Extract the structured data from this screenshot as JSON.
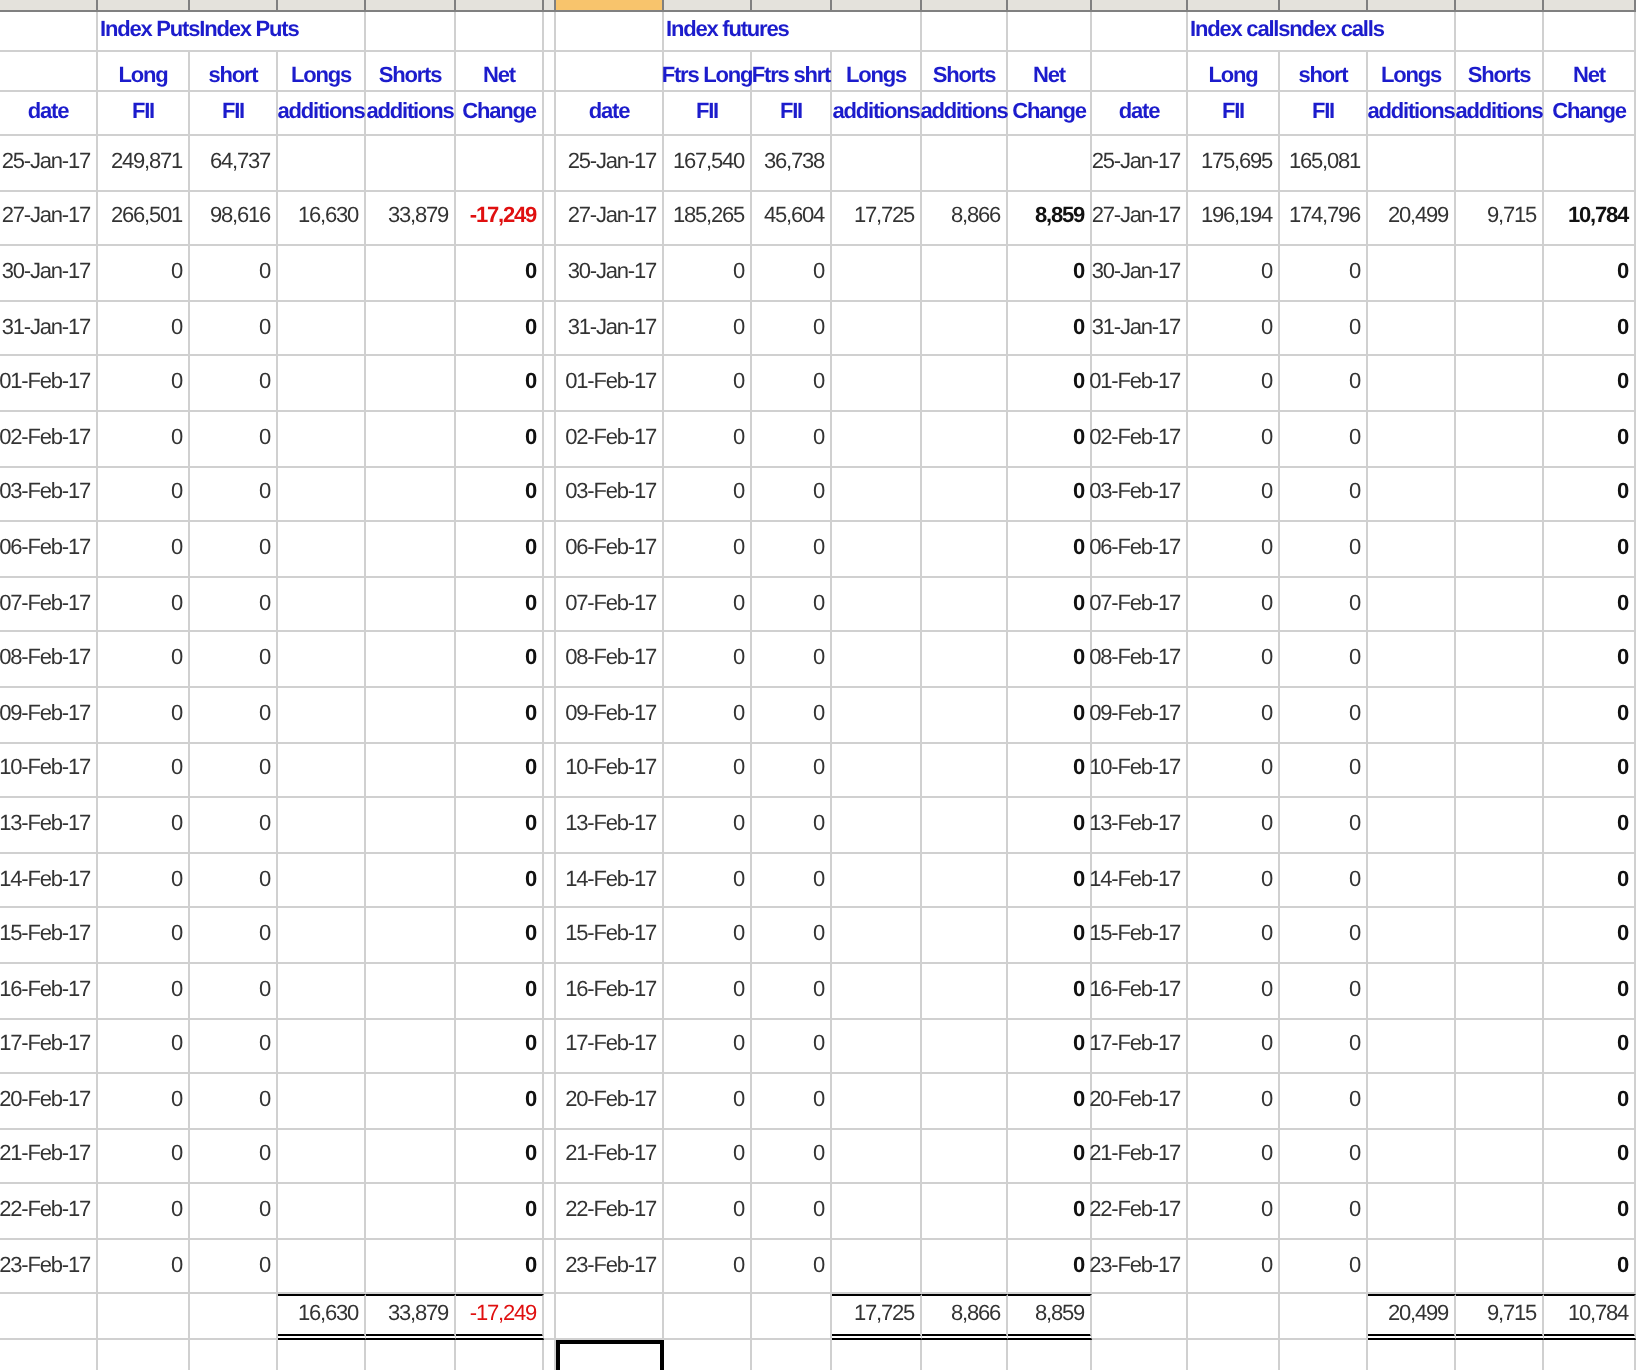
{
  "header_strip": [
    {
      "selected": false
    },
    {
      "selected": false
    },
    {
      "selected": false
    },
    {
      "selected": false
    },
    {
      "selected": false
    },
    {
      "selected": false
    },
    {
      "selected": false
    },
    {
      "selected": true
    },
    {
      "selected": false
    },
    {
      "selected": false
    },
    {
      "selected": false
    },
    {
      "selected": false
    },
    {
      "selected": false
    },
    {
      "selected": false
    },
    {
      "selected": false
    },
    {
      "selected": false
    },
    {
      "selected": false
    },
    {
      "selected": false
    },
    {
      "selected": false
    }
  ],
  "sections": [
    {
      "title": "Index PutsIndex Puts",
      "headings": [
        {
          "bottom": "date"
        },
        {
          "top": "Long",
          "bottom": "FII"
        },
        {
          "top": "short",
          "bottom": "FII"
        },
        {
          "top": "Longs",
          "bottom": "additions"
        },
        {
          "top": "Shorts",
          "bottom": "additions"
        },
        {
          "top": "Net",
          "bottom": "Change"
        }
      ],
      "rows": [
        {
          "date": "25-Jan-17",
          "long": "249,871",
          "short": "64,737"
        },
        {
          "date": "27-Jan-17",
          "long": "266,501",
          "short": "98,616",
          "longs_add": "16,630",
          "shorts_add": "33,879",
          "net": "-17,249",
          "negative": true
        },
        {
          "date": "30-Jan-17",
          "long": "0",
          "short": "0",
          "net": "0",
          "negative": false
        },
        {
          "date": "31-Jan-17",
          "long": "0",
          "short": "0",
          "net": "0",
          "negative": false
        },
        {
          "date": "01-Feb-17",
          "long": "0",
          "short": "0",
          "net": "0",
          "negative": false
        },
        {
          "date": "02-Feb-17",
          "long": "0",
          "short": "0",
          "net": "0",
          "negative": false
        },
        {
          "date": "03-Feb-17",
          "long": "0",
          "short": "0",
          "net": "0",
          "negative": false
        },
        {
          "date": "06-Feb-17",
          "long": "0",
          "short": "0",
          "net": "0",
          "negative": false
        },
        {
          "date": "07-Feb-17",
          "long": "0",
          "short": "0",
          "net": "0",
          "negative": false
        },
        {
          "date": "08-Feb-17",
          "long": "0",
          "short": "0",
          "net": "0",
          "negative": false
        },
        {
          "date": "09-Feb-17",
          "long": "0",
          "short": "0",
          "net": "0",
          "negative": false
        },
        {
          "date": "10-Feb-17",
          "long": "0",
          "short": "0",
          "net": "0",
          "negative": false
        },
        {
          "date": "13-Feb-17",
          "long": "0",
          "short": "0",
          "net": "0",
          "negative": false
        },
        {
          "date": "14-Feb-17",
          "long": "0",
          "short": "0",
          "net": "0",
          "negative": false
        },
        {
          "date": "15-Feb-17",
          "long": "0",
          "short": "0",
          "net": "0",
          "negative": false
        },
        {
          "date": "16-Feb-17",
          "long": "0",
          "short": "0",
          "net": "0",
          "negative": false
        },
        {
          "date": "17-Feb-17",
          "long": "0",
          "short": "0",
          "net": "0",
          "negative": false
        },
        {
          "date": "20-Feb-17",
          "long": "0",
          "short": "0",
          "net": "0",
          "negative": false
        },
        {
          "date": "21-Feb-17",
          "long": "0",
          "short": "0",
          "net": "0",
          "negative": false
        },
        {
          "date": "22-Feb-17",
          "long": "0",
          "short": "0",
          "net": "0",
          "negative": false
        },
        {
          "date": "23-Feb-17",
          "long": "0",
          "short": "0",
          "net": "0",
          "negative": false
        }
      ],
      "totals": {
        "longs_add": "16,630",
        "shorts_add": "33,879",
        "net": "-17,249",
        "negative": true
      }
    },
    {
      "title": "Index futures",
      "headings": [
        {
          "bottom": "date"
        },
        {
          "top": "Ftrs Long",
          "bottom": "FII"
        },
        {
          "top": "Ftrs shrt",
          "bottom": "FII"
        },
        {
          "top": "Longs",
          "bottom": "additions"
        },
        {
          "top": "Shorts",
          "bottom": "additions"
        },
        {
          "top": "Net",
          "bottom": "Change"
        }
      ],
      "rows": [
        {
          "date": "25-Jan-17",
          "long": "167,540",
          "short": "36,738"
        },
        {
          "date": "27-Jan-17",
          "long": "185,265",
          "short": "45,604",
          "longs_add": "17,725",
          "shorts_add": "8,866",
          "net": "8,859",
          "negative": false
        },
        {
          "date": "30-Jan-17",
          "long": "0",
          "short": "0",
          "net": "0",
          "negative": false
        },
        {
          "date": "31-Jan-17",
          "long": "0",
          "short": "0",
          "net": "0",
          "negative": false
        },
        {
          "date": "01-Feb-17",
          "long": "0",
          "short": "0",
          "net": "0",
          "negative": false
        },
        {
          "date": "02-Feb-17",
          "long": "0",
          "short": "0",
          "net": "0",
          "negative": false
        },
        {
          "date": "03-Feb-17",
          "long": "0",
          "short": "0",
          "net": "0",
          "negative": false
        },
        {
          "date": "06-Feb-17",
          "long": "0",
          "short": "0",
          "net": "0",
          "negative": false
        },
        {
          "date": "07-Feb-17",
          "long": "0",
          "short": "0",
          "net": "0",
          "negative": false
        },
        {
          "date": "08-Feb-17",
          "long": "0",
          "short": "0",
          "net": "0",
          "negative": false
        },
        {
          "date": "09-Feb-17",
          "long": "0",
          "short": "0",
          "net": "0",
          "negative": false
        },
        {
          "date": "10-Feb-17",
          "long": "0",
          "short": "0",
          "net": "0",
          "negative": false
        },
        {
          "date": "13-Feb-17",
          "long": "0",
          "short": "0",
          "net": "0",
          "negative": false
        },
        {
          "date": "14-Feb-17",
          "long": "0",
          "short": "0",
          "net": "0",
          "negative": false
        },
        {
          "date": "15-Feb-17",
          "long": "0",
          "short": "0",
          "net": "0",
          "negative": false
        },
        {
          "date": "16-Feb-17",
          "long": "0",
          "short": "0",
          "net": "0",
          "negative": false
        },
        {
          "date": "17-Feb-17",
          "long": "0",
          "short": "0",
          "net": "0",
          "negative": false
        },
        {
          "date": "20-Feb-17",
          "long": "0",
          "short": "0",
          "net": "0",
          "negative": false
        },
        {
          "date": "21-Feb-17",
          "long": "0",
          "short": "0",
          "net": "0",
          "negative": false
        },
        {
          "date": "22-Feb-17",
          "long": "0",
          "short": "0",
          "net": "0",
          "negative": false
        },
        {
          "date": "23-Feb-17",
          "long": "0",
          "short": "0",
          "net": "0",
          "negative": false
        }
      ],
      "totals": {
        "longs_add": "17,725",
        "shorts_add": "8,866",
        "net": "8,859",
        "negative": false
      }
    },
    {
      "title": "Index callsndex calls",
      "headings": [
        {
          "bottom": "date"
        },
        {
          "top": "Long",
          "bottom": "FII"
        },
        {
          "top": "short",
          "bottom": "FII"
        },
        {
          "top": "Longs",
          "bottom": "additions"
        },
        {
          "top": "Shorts",
          "bottom": "additions"
        },
        {
          "top": "Net",
          "bottom": "Change"
        }
      ],
      "rows": [
        {
          "date": "25-Jan-17",
          "long": "175,695",
          "short": "165,081"
        },
        {
          "date": "27-Jan-17",
          "long": "196,194",
          "short": "174,796",
          "longs_add": "20,499",
          "shorts_add": "9,715",
          "net": "10,784",
          "negative": false
        },
        {
          "date": "30-Jan-17",
          "long": "0",
          "short": "0",
          "net": "0",
          "negative": false
        },
        {
          "date": "31-Jan-17",
          "long": "0",
          "short": "0",
          "net": "0",
          "negative": false
        },
        {
          "date": "01-Feb-17",
          "long": "0",
          "short": "0",
          "net": "0",
          "negative": false
        },
        {
          "date": "02-Feb-17",
          "long": "0",
          "short": "0",
          "net": "0",
          "negative": false
        },
        {
          "date": "03-Feb-17",
          "long": "0",
          "short": "0",
          "net": "0",
          "negative": false
        },
        {
          "date": "06-Feb-17",
          "long": "0",
          "short": "0",
          "net": "0",
          "negative": false
        },
        {
          "date": "07-Feb-17",
          "long": "0",
          "short": "0",
          "net": "0",
          "negative": false
        },
        {
          "date": "08-Feb-17",
          "long": "0",
          "short": "0",
          "net": "0",
          "negative": false
        },
        {
          "date": "09-Feb-17",
          "long": "0",
          "short": "0",
          "net": "0",
          "negative": false
        },
        {
          "date": "10-Feb-17",
          "long": "0",
          "short": "0",
          "net": "0",
          "negative": false
        },
        {
          "date": "13-Feb-17",
          "long": "0",
          "short": "0",
          "net": "0",
          "negative": false
        },
        {
          "date": "14-Feb-17",
          "long": "0",
          "short": "0",
          "net": "0",
          "negative": false
        },
        {
          "date": "15-Feb-17",
          "long": "0",
          "short": "0",
          "net": "0",
          "negative": false
        },
        {
          "date": "16-Feb-17",
          "long": "0",
          "short": "0",
          "net": "0",
          "negative": false
        },
        {
          "date": "17-Feb-17",
          "long": "0",
          "short": "0",
          "net": "0",
          "negative": false
        },
        {
          "date": "20-Feb-17",
          "long": "0",
          "short": "0",
          "net": "0",
          "negative": false
        },
        {
          "date": "21-Feb-17",
          "long": "0",
          "short": "0",
          "net": "0",
          "negative": false
        },
        {
          "date": "22-Feb-17",
          "long": "0",
          "short": "0",
          "net": "0",
          "negative": false
        },
        {
          "date": "23-Feb-17",
          "long": "0",
          "short": "0",
          "net": "0",
          "negative": false
        }
      ],
      "totals": {
        "longs_add": "20,499",
        "shorts_add": "9,715",
        "net": "10,784",
        "negative": false
      }
    }
  ],
  "cursor_row": [
    {
      "selected": false
    },
    {
      "selected": false
    },
    {
      "selected": false
    },
    {
      "selected": false
    },
    {
      "selected": false
    },
    {
      "selected": false
    },
    {
      "selected": false
    },
    {
      "selected": true
    },
    {
      "selected": false
    },
    {
      "selected": false
    },
    {
      "selected": false
    },
    {
      "selected": false
    },
    {
      "selected": false
    },
    {
      "selected": false
    },
    {
      "selected": false
    },
    {
      "selected": false
    },
    {
      "selected": false
    },
    {
      "selected": false
    },
    {
      "selected": false
    }
  ]
}
